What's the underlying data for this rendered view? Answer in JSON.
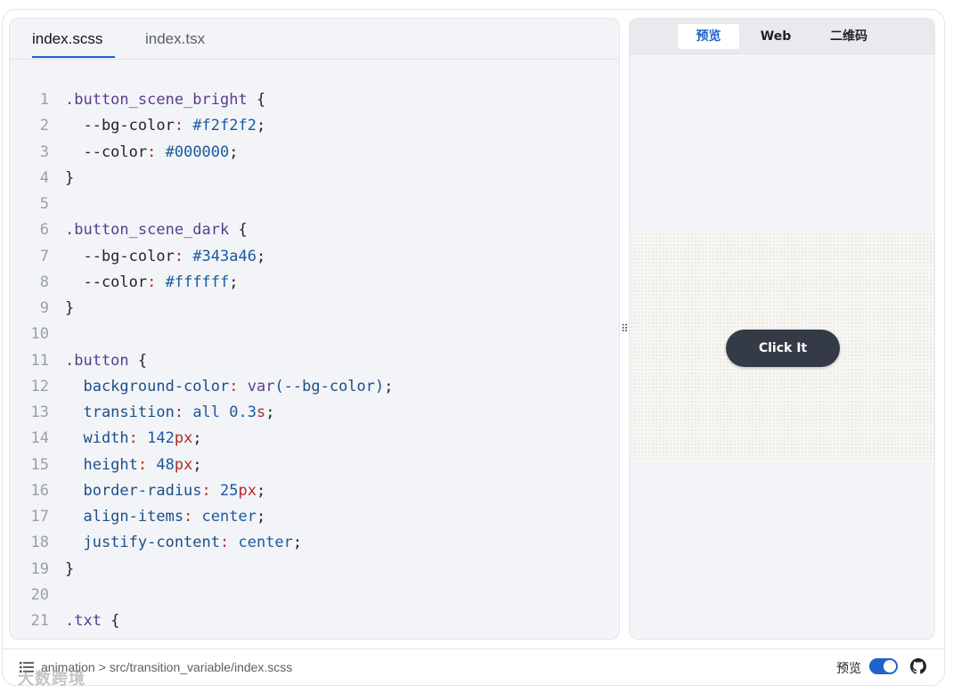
{
  "editor": {
    "tabs": [
      {
        "label": "index.scss",
        "active": true
      },
      {
        "label": "index.tsx",
        "active": false
      }
    ],
    "code_lines": [
      {
        "n": "1",
        "tokens": [
          {
            "t": ".button_scene_bright",
            "c": "sel"
          },
          {
            "t": " {",
            "c": "punc"
          }
        ]
      },
      {
        "n": "2",
        "tokens": [
          {
            "t": "  --bg-color",
            "c": "punc"
          },
          {
            "t": ":",
            "c": "colon"
          },
          {
            "t": " #f2f2f2",
            "c": "val"
          },
          {
            "t": ";",
            "c": "punc"
          }
        ]
      },
      {
        "n": "3",
        "tokens": [
          {
            "t": "  --color",
            "c": "punc"
          },
          {
            "t": ":",
            "c": "colon"
          },
          {
            "t": " #000000",
            "c": "val"
          },
          {
            "t": ";",
            "c": "punc"
          }
        ]
      },
      {
        "n": "4",
        "tokens": [
          {
            "t": "}",
            "c": "punc"
          }
        ]
      },
      {
        "n": "5",
        "tokens": []
      },
      {
        "n": "6",
        "tokens": [
          {
            "t": ".button_scene_dark",
            "c": "sel"
          },
          {
            "t": " {",
            "c": "punc"
          }
        ]
      },
      {
        "n": "7",
        "tokens": [
          {
            "t": "  --bg-color",
            "c": "punc"
          },
          {
            "t": ":",
            "c": "colon"
          },
          {
            "t": " #343a46",
            "c": "val"
          },
          {
            "t": ";",
            "c": "punc"
          }
        ]
      },
      {
        "n": "8",
        "tokens": [
          {
            "t": "  --color",
            "c": "punc"
          },
          {
            "t": ":",
            "c": "colon"
          },
          {
            "t": " #ffffff",
            "c": "val"
          },
          {
            "t": ";",
            "c": "punc"
          }
        ]
      },
      {
        "n": "9",
        "tokens": [
          {
            "t": "}",
            "c": "punc"
          }
        ]
      },
      {
        "n": "10",
        "tokens": []
      },
      {
        "n": "11",
        "tokens": [
          {
            "t": ".button",
            "c": "sel"
          },
          {
            "t": " {",
            "c": "punc"
          }
        ]
      },
      {
        "n": "12",
        "tokens": [
          {
            "t": "  background-color",
            "c": "prop"
          },
          {
            "t": ":",
            "c": "colon"
          },
          {
            "t": " var",
            "c": "sel"
          },
          {
            "t": "(--bg-color)",
            "c": "prop"
          },
          {
            "t": ";",
            "c": "punc"
          }
        ]
      },
      {
        "n": "13",
        "tokens": [
          {
            "t": "  transition",
            "c": "prop"
          },
          {
            "t": ":",
            "c": "colon"
          },
          {
            "t": " all",
            "c": "val"
          },
          {
            "t": " 0.3",
            "c": "num"
          },
          {
            "t": "s",
            "c": "unit"
          },
          {
            "t": ";",
            "c": "punc"
          }
        ]
      },
      {
        "n": "14",
        "tokens": [
          {
            "t": "  width",
            "c": "prop"
          },
          {
            "t": ":",
            "c": "colon"
          },
          {
            "t": " 142",
            "c": "num"
          },
          {
            "t": "px",
            "c": "unit"
          },
          {
            "t": ";",
            "c": "punc"
          }
        ]
      },
      {
        "n": "15",
        "tokens": [
          {
            "t": "  height",
            "c": "prop"
          },
          {
            "t": ":",
            "c": "colon"
          },
          {
            "t": " 48",
            "c": "num"
          },
          {
            "t": "px",
            "c": "unit"
          },
          {
            "t": ";",
            "c": "punc"
          }
        ]
      },
      {
        "n": "16",
        "tokens": [
          {
            "t": "  border-radius",
            "c": "prop"
          },
          {
            "t": ":",
            "c": "colon"
          },
          {
            "t": " 25",
            "c": "num"
          },
          {
            "t": "px",
            "c": "unit"
          },
          {
            "t": ";",
            "c": "punc"
          }
        ]
      },
      {
        "n": "17",
        "tokens": [
          {
            "t": "  align-items",
            "c": "prop"
          },
          {
            "t": ":",
            "c": "colon"
          },
          {
            "t": " center",
            "c": "val"
          },
          {
            "t": ";",
            "c": "punc"
          }
        ]
      },
      {
        "n": "18",
        "tokens": [
          {
            "t": "  justify-content",
            "c": "prop"
          },
          {
            "t": ":",
            "c": "colon"
          },
          {
            "t": " center",
            "c": "val"
          },
          {
            "t": ";",
            "c": "punc"
          }
        ]
      },
      {
        "n": "19",
        "tokens": [
          {
            "t": "}",
            "c": "punc"
          }
        ]
      },
      {
        "n": "20",
        "tokens": []
      },
      {
        "n": "21",
        "tokens": [
          {
            "t": ".txt",
            "c": "sel"
          },
          {
            "t": " {",
            "c": "punc"
          }
        ]
      }
    ]
  },
  "preview": {
    "tabs": [
      {
        "label": "预览",
        "active": true
      },
      {
        "label": "Web",
        "active": false
      },
      {
        "label": "二维码",
        "active": false
      }
    ],
    "demo_button_label": "Click It",
    "demo_button_color": "#343a46"
  },
  "footer": {
    "crumb_root": "animation",
    "crumb_separator": ">",
    "crumb_path": "src/transition_variable/index.scss",
    "preview_toggle_label": "预览",
    "preview_toggle_on": true,
    "watermark": "大数跨境",
    "icons": [
      "menu-icon",
      "github-icon"
    ]
  },
  "colors": {
    "accent": "#1e63c9",
    "editor_bg": "#f3f4f7",
    "selector": "#5b3c8f",
    "property": "#1b4f8a",
    "unit": "#b02a2a"
  }
}
